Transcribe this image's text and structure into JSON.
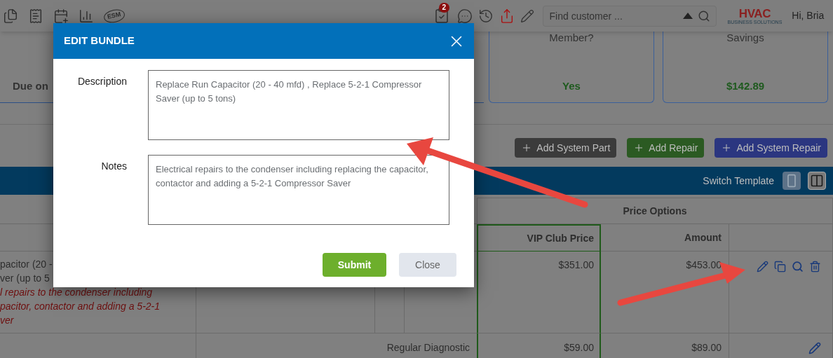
{
  "header": {
    "esm_label": "ESM",
    "tasks_badge": "2",
    "search": {
      "placeholder": "Find customer ..."
    },
    "logo": {
      "text": "HVAC",
      "tagline": "BUSINESS SOLUTIONS"
    },
    "greeting": "Hi, Bria"
  },
  "due_label": "Due on",
  "summary_cards": [
    {
      "title": "Member?",
      "value": "Yes"
    },
    {
      "title": "Savings",
      "value": "$142.89"
    }
  ],
  "actions": [
    {
      "label": "Add System Part",
      "color": "#3b3b3b"
    },
    {
      "label": "Add Repair",
      "color": "#2b5a22"
    },
    {
      "label": "Add System Repair",
      "color": "#2b3680"
    }
  ],
  "template_bar": {
    "label": "Switch Template",
    "views": [
      {
        "kind": "single",
        "selected": true
      },
      {
        "kind": "split",
        "selected": false
      }
    ]
  },
  "table": {
    "group_header": "Price Options",
    "columns": [
      "VIP Club Price",
      "Amount"
    ],
    "rows": [
      {
        "kind": "bundle",
        "description_lines": [
          "pacitor (20 -",
          "ver (up to 5"
        ],
        "notes_lines": [
          "l repairs to the condenser including",
          "pacitor, contactor and adding a 5-2-1",
          "ver"
        ],
        "vip_price": "$351.00",
        "amount": "$453.00"
      },
      {
        "kind": "item",
        "service": "Regular Diagnostic",
        "vip_price": "$59.00",
        "amount": "$89.00"
      }
    ]
  },
  "dialog": {
    "title": "EDIT BUNDLE",
    "fields": [
      {
        "label": "Description",
        "value": "Replace Run Capacitor (20 - 40 mfd) , Replace 5-2-1 Compressor Saver (up to 5 tons)"
      },
      {
        "label": "Notes",
        "value": "Electrical repairs to the condenser including replacing the capacitor, contactor and adding a 5-2-1 Compressor Saver"
      }
    ],
    "buttons": [
      {
        "label": "Submit",
        "kind": "primary"
      },
      {
        "label": "Close",
        "kind": "secondary"
      }
    ]
  }
}
